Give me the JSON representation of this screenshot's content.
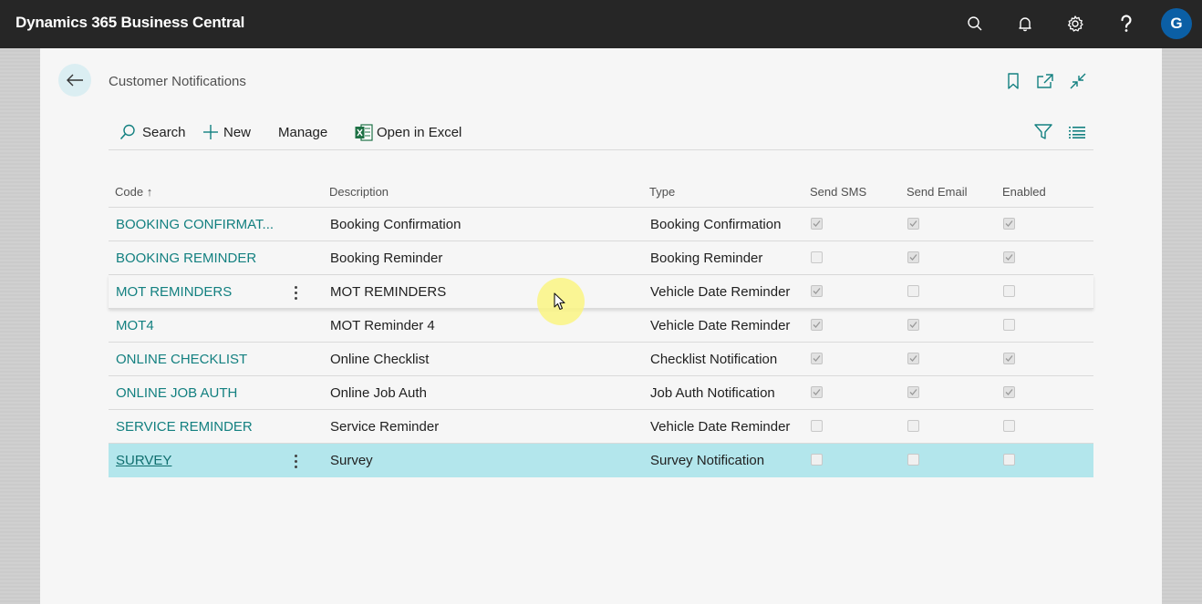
{
  "appbar": {
    "title": "Dynamics 365 Business Central",
    "avatar_initial": "G",
    "icons": [
      "search-icon",
      "bell-icon",
      "gear-icon",
      "help-icon"
    ]
  },
  "page": {
    "caption": "Customer Notifications",
    "top_icons": [
      "bookmark-icon",
      "open-new-window-icon",
      "collapse-icon"
    ]
  },
  "actions": {
    "search": "Search",
    "new": "New",
    "manage": "Manage",
    "excel": "Open in Excel"
  },
  "columns": {
    "code": "Code",
    "sort_indicator": "↑",
    "description": "Description",
    "type": "Type",
    "send_sms": "Send SMS",
    "send_email": "Send Email",
    "enabled": "Enabled"
  },
  "rows": [
    {
      "code": "BOOKING CONFIRMAT...",
      "description": "Booking Confirmation",
      "type": "Booking Confirmation",
      "send_sms": true,
      "send_email": true,
      "enabled": true
    },
    {
      "code": "BOOKING REMINDER",
      "description": "Booking Reminder",
      "type": "Booking Reminder",
      "send_sms": false,
      "send_email": true,
      "enabled": true
    },
    {
      "code": "MOT REMINDERS",
      "description": "MOT REMINDERS",
      "type": "Vehicle Date Reminder",
      "send_sms": true,
      "send_email": false,
      "enabled": false
    },
    {
      "code": "MOT4",
      "description": "MOT Reminder 4",
      "type": "Vehicle Date Reminder",
      "send_sms": true,
      "send_email": true,
      "enabled": false
    },
    {
      "code": "ONLINE CHECKLIST",
      "description": "Online Checklist",
      "type": "Checklist Notification",
      "send_sms": true,
      "send_email": true,
      "enabled": true
    },
    {
      "code": "ONLINE JOB AUTH",
      "description": "Online Job Auth",
      "type": "Job Auth Notification",
      "send_sms": true,
      "send_email": true,
      "enabled": true
    },
    {
      "code": "SERVICE REMINDER",
      "description": "Service Reminder",
      "type": "Vehicle Date Reminder",
      "send_sms": false,
      "send_email": false,
      "enabled": false
    },
    {
      "code": "SURVEY",
      "description": "Survey",
      "type": "Survey Notification",
      "send_sms": false,
      "send_email": false,
      "enabled": false
    }
  ],
  "colors": {
    "appbar_bg": "#262626",
    "link": "#138080",
    "selected_row": "#b3e6ec",
    "avatar": "#0b5fa5",
    "excel_green": "#1e7145"
  }
}
